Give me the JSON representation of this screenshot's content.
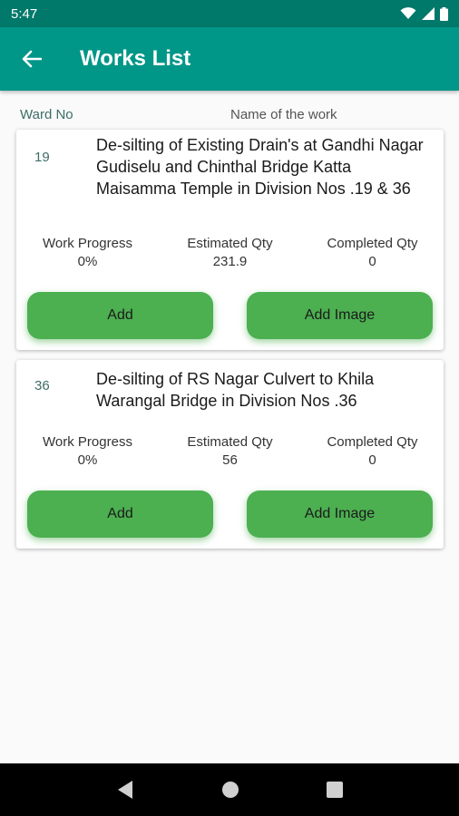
{
  "status_bar": {
    "time": "5:47"
  },
  "app_bar": {
    "title": "Works List"
  },
  "headers": {
    "ward_no": "Ward No",
    "name_of_work": "Name of the work"
  },
  "works": [
    {
      "ward_no": "19",
      "name": "De-silting of Existing Drain's at Gandhi Nagar Gudiselu and Chinthal Bridge Katta Maisamma Temple in Division Nos .19 & 36",
      "progress_label": "Work Progress",
      "progress_value": "0%",
      "estimated_label": "Estimated Qty",
      "estimated_value": "231.9",
      "completed_label": "Completed Qty",
      "completed_value": "0",
      "add_label": "Add",
      "add_image_label": "Add Image"
    },
    {
      "ward_no": "36",
      "name": "De-silting of RS Nagar Culvert to Khila Warangal Bridge in Division Nos .36",
      "progress_label": "Work Progress",
      "progress_value": "0%",
      "estimated_label": "Estimated Qty",
      "estimated_value": "56",
      "completed_label": "Completed Qty",
      "completed_value": "0",
      "add_label": "Add",
      "add_image_label": "Add Image"
    }
  ],
  "colors": {
    "status_bar": "#00786a",
    "app_bar": "#009688",
    "button": "#4caf50",
    "ward_text": "#3d6e66"
  },
  "icons": [
    "wifi-icon",
    "signal-icon",
    "battery-icon",
    "back-arrow-icon",
    "nav-back-icon",
    "nav-home-icon",
    "nav-recents-icon"
  ]
}
